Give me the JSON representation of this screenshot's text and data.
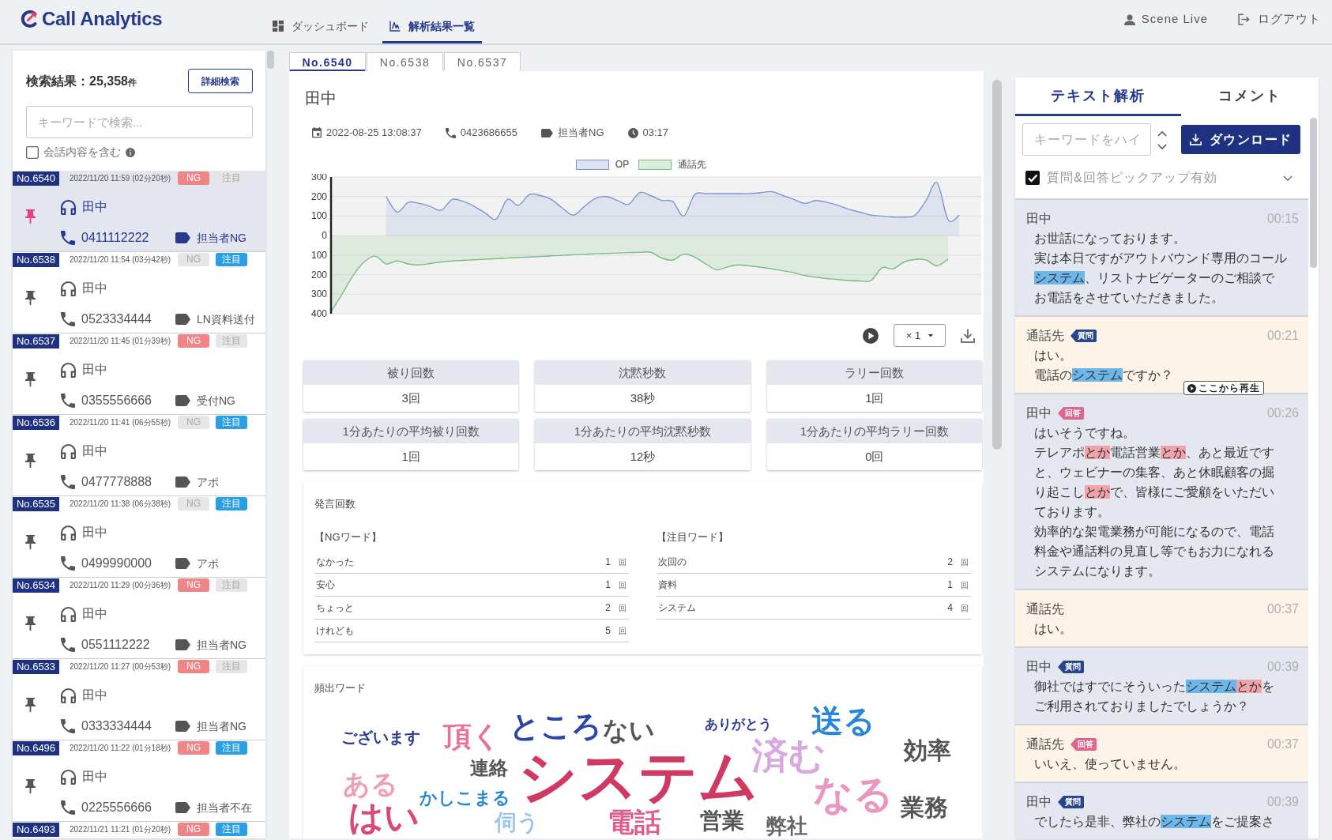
{
  "header": {
    "logo": "Call Analytics",
    "nav": [
      {
        "label": "ダッシュボード",
        "kind": "dashboard",
        "selected": false
      },
      {
        "label": "解析結果一覧",
        "kind": "analysis",
        "selected": true
      }
    ],
    "user": "Scene Live",
    "logout": "ログアウト"
  },
  "sidebar": {
    "result": {
      "label": "検索結果：",
      "count": "25,358",
      "unit": "件"
    },
    "detail_search": "詳細検索",
    "search": {
      "placeholder": "キーワードで検索..."
    },
    "include_conversation": {
      "label": "会話内容を含む",
      "checked": false
    },
    "calls": [
      {
        "no": "No.6540",
        "datetime": "2022/11/20 11:59 (02分20秒)",
        "badges": [
          {
            "kind": "ng",
            "label": "NG",
            "on": true
          },
          {
            "kind": "attention",
            "label": "注目",
            "on": false
          }
        ],
        "selected": true,
        "pinned": true,
        "name": "田中",
        "phone": "0411112222",
        "tag": "担当者NG"
      },
      {
        "no": "No.6538",
        "datetime": "2022/11/20 11:54 (03分42秒)",
        "badges": [
          {
            "kind": "ng",
            "label": "NG",
            "on": false
          },
          {
            "kind": "attention",
            "label": "注目",
            "on": true
          }
        ],
        "selected": false,
        "pinned": false,
        "name": "田中",
        "phone": "0523334444",
        "tag": "LN資料送付"
      },
      {
        "no": "No.6537",
        "datetime": "2022/11/20 11:45 (01分39秒)",
        "badges": [
          {
            "kind": "ng",
            "label": "NG",
            "on": true
          },
          {
            "kind": "attention",
            "label": "注目",
            "on": false
          }
        ],
        "selected": false,
        "pinned": false,
        "name": "田中",
        "phone": "0355556666",
        "tag": "受付NG"
      },
      {
        "no": "No.6536",
        "datetime": "2022/11/20 11:41 (06分55秒)",
        "badges": [
          {
            "kind": "ng",
            "label": "NG",
            "on": false
          },
          {
            "kind": "attention",
            "label": "注目",
            "on": true
          }
        ],
        "selected": false,
        "pinned": false,
        "name": "田中",
        "phone": "0477778888",
        "tag": "アポ"
      },
      {
        "no": "No.6535",
        "datetime": "2022/11/20 11:38 (06分38秒)",
        "badges": [
          {
            "kind": "ng",
            "label": "NG",
            "on": false
          },
          {
            "kind": "attention",
            "label": "注目",
            "on": true
          }
        ],
        "selected": false,
        "pinned": false,
        "name": "田中",
        "phone": "0499990000",
        "tag": "アポ"
      },
      {
        "no": "No.6534",
        "datetime": "2022/11/20 11:29 (00分36秒)",
        "badges": [
          {
            "kind": "ng",
            "label": "NG",
            "on": true
          },
          {
            "kind": "attention",
            "label": "注目",
            "on": false
          }
        ],
        "selected": false,
        "pinned": false,
        "name": "田中",
        "phone": "0551112222",
        "tag": "担当者NG"
      },
      {
        "no": "No.6533",
        "datetime": "2022/11/20 11:27 (00分53秒)",
        "badges": [
          {
            "kind": "ng",
            "label": "NG",
            "on": true
          },
          {
            "kind": "attention",
            "label": "注目",
            "on": false
          }
        ],
        "selected": false,
        "pinned": false,
        "name": "田中",
        "phone": "0333334444",
        "tag": "担当者NG"
      },
      {
        "no": "No.6496",
        "datetime": "2022/11/20 11:22 (01分18秒)",
        "badges": [
          {
            "kind": "ng",
            "label": "NG",
            "on": true
          },
          {
            "kind": "attention",
            "label": "注目",
            "on": true
          }
        ],
        "selected": false,
        "pinned": false,
        "name": "田中",
        "phone": "0225556666",
        "tag": "担当者不在"
      },
      {
        "no": "No.6493",
        "datetime": "2022/11/21 11:21 (01分20秒)",
        "badges": [
          {
            "kind": "ng",
            "label": "NG",
            "on": true
          },
          {
            "kind": "attention",
            "label": "注目",
            "on": true
          }
        ],
        "selected": false
      }
    ]
  },
  "tabs": [
    {
      "label": "No.6540",
      "selected": true
    },
    {
      "label": "No.6538",
      "selected": false
    },
    {
      "label": "No.6537",
      "selected": false
    }
  ],
  "detail": {
    "title": "田中",
    "meta": [
      {
        "kind": "date",
        "text": "2022-08-25 13:08:37"
      },
      {
        "kind": "phone",
        "text": "0423686655"
      },
      {
        "kind": "tag",
        "text": "担当者NG"
      },
      {
        "kind": "duration",
        "text": "03:17"
      }
    ],
    "chart_data": {
      "type": "area",
      "legend": "top",
      "grid": true,
      "series": [
        {
          "name": "OP",
          "color": "#7d97d1",
          "values": [
            null,
            null,
            null,
            null,
            null,
            200,
            120,
            170,
            165,
            150,
            130,
            185,
            175,
            150,
            115,
            85,
            185,
            155,
            210,
            205,
            185,
            140,
            105,
            150,
            190,
            200,
            180,
            160,
            220,
            205,
            180,
            175,
            100,
            210,
            215,
            215,
            215,
            215,
            215,
            220,
            225,
            205,
            185,
            165,
            180,
            170,
            155,
            135,
            120,
            105,
            100,
            95,
            95,
            105,
            180,
            270,
            80,
            105,
            null,
            null
          ]
        },
        {
          "name": "通話先",
          "color": "#78bf7f",
          "values": [
            -390,
            -300,
            -205,
            -135,
            -105,
            -145,
            -130,
            -145,
            -150,
            -143,
            -135,
            -130,
            -127,
            -124,
            -121,
            -118,
            -115,
            -112,
            -110,
            -107,
            -104,
            -101,
            -98,
            -96,
            -93,
            -91,
            -89,
            -87,
            -86,
            -85,
            -115,
            -125,
            -95,
            -110,
            -145,
            -175,
            -160,
            -150,
            -155,
            -162,
            -170,
            -180,
            -190,
            -205,
            -213,
            -220,
            -225,
            -230,
            -232,
            -230,
            -165,
            -170,
            -135,
            -122,
            -125,
            -155,
            -120,
            null,
            null,
            null
          ]
        }
      ],
      "ylim": [
        -400,
        300
      ],
      "yticks": [
        300,
        200,
        100,
        0,
        {
          "value": -100,
          "label": "100"
        },
        {
          "value": -200,
          "label": "200"
        },
        {
          "value": -300,
          "label": "300"
        },
        {
          "value": -400,
          "label": "400"
        }
      ]
    },
    "speed": "× 1",
    "stats": [
      {
        "label": "被り回数",
        "value": "3回"
      },
      {
        "label": "沈黙秒数",
        "value": "38秒"
      },
      {
        "label": "ラリー回数",
        "value": "1回"
      },
      {
        "label": "1分あたりの平均被り回数",
        "value": "1回"
      },
      {
        "label": "1分あたりの平均沈黙秒数",
        "value": "12秒"
      },
      {
        "label": "1分あたりの平均ラリー回数",
        "value": "0回"
      }
    ],
    "word_counts": {
      "title": "発言回数",
      "groups": [
        {
          "title": "【NGワード】",
          "rows": [
            {
              "word": "なかった",
              "count": "1",
              "unit": "回"
            },
            {
              "word": "安心",
              "count": "1",
              "unit": "回"
            },
            {
              "word": "ちょっと",
              "count": "2",
              "unit": "回"
            },
            {
              "word": "けれども",
              "count": "5",
              "unit": "回"
            }
          ]
        },
        {
          "title": "【注目ワード】",
          "rows": [
            {
              "word": "次回の",
              "count": "2",
              "unit": "回"
            },
            {
              "word": "資料",
              "count": "1",
              "unit": "回"
            },
            {
              "word": "システム",
              "count": "4",
              "unit": "回"
            }
          ]
        }
      ]
    },
    "word_cloud": {
      "title": "頻出ワード",
      "words": [
        {
          "text": "ございます",
          "color": "#2c3b92"
        },
        {
          "text": "頂く",
          "color": "#e8709a"
        },
        {
          "text": "ところ",
          "color": "#2c44a8"
        },
        {
          "text": "ない",
          "color": "#555555"
        },
        {
          "text": "ありがとう",
          "color": "#2c3b92"
        },
        {
          "text": "送る",
          "color": "#2a86d6"
        },
        {
          "text": "ある",
          "color": "#ef9fb5"
        },
        {
          "text": "連絡",
          "color": "#555555"
        },
        {
          "text": "かしこまる",
          "color": "#2a86d6"
        },
        {
          "text": "システム",
          "color": "#d03a62"
        },
        {
          "text": "済む",
          "color": "#d8a8e0"
        },
        {
          "text": "なる",
          "color": "#e996c0"
        },
        {
          "text": "効率",
          "color": "#555555"
        },
        {
          "text": "はい",
          "color": "#d8487a"
        },
        {
          "text": "伺う",
          "color": "#9fc7ee"
        },
        {
          "text": "電話",
          "color": "#e05c8c"
        },
        {
          "text": "営業",
          "color": "#555555"
        },
        {
          "text": "弊社",
          "color": "#666666"
        },
        {
          "text": "業務",
          "color": "#555555"
        }
      ]
    }
  },
  "transcript": {
    "tabs": [
      {
        "label": "テキスト解析",
        "selected": true
      },
      {
        "label": "コメント",
        "selected": false
      }
    ],
    "highlight": {
      "placeholder": "キーワードをハイ"
    },
    "download": "ダウンロード",
    "pickup": {
      "label": "質問&回答ピックアップ有効",
      "checked": true
    },
    "utterances": [
      {
        "speaker": "田中",
        "kind": "operator",
        "time": "00:15",
        "lines": [
          [
            {
              "text": "お世話になっております。",
              "kind": "plain"
            }
          ],
          [
            {
              "text": "実は本日ですがアウトバウンド専用のコール",
              "kind": "plain"
            }
          ],
          [
            {
              "text": "システム",
              "kind": "keyword"
            },
            {
              "text": "、リストナビゲーターのご相談で",
              "kind": "plain"
            }
          ],
          [
            {
              "text": "お電話をさせていただきました。",
              "kind": "plain"
            }
          ]
        ]
      },
      {
        "speaker": "通話先",
        "kind": "customer",
        "tag": {
          "kind": "question",
          "label": "質問"
        },
        "time": "00:21",
        "lines": [
          [
            {
              "text": "はい。",
              "kind": "plain"
            }
          ],
          [
            {
              "text": "電話の",
              "kind": "plain"
            },
            {
              "text": "システム",
              "kind": "keyword"
            },
            {
              "text": "ですか？",
              "kind": "plain"
            }
          ]
        ],
        "play": "ここから再生"
      },
      {
        "speaker": "田中",
        "kind": "operator",
        "tag": {
          "kind": "answer",
          "label": "回答"
        },
        "time": "00:26",
        "lines": [
          [
            {
              "text": "はいそうですね。",
              "kind": "plain"
            }
          ],
          [
            {
              "text": "テレアポ",
              "kind": "plain"
            },
            {
              "text": "とか",
              "kind": "ng"
            },
            {
              "text": "電話営業",
              "kind": "plain"
            },
            {
              "text": "とか",
              "kind": "ng"
            },
            {
              "text": "、あと最近です",
              "kind": "plain"
            }
          ],
          [
            {
              "text": "と、ウェビナーの集客、あと休眠顧客の掘",
              "kind": "plain"
            }
          ],
          [
            {
              "text": "り起こし",
              "kind": "plain"
            },
            {
              "text": "とか",
              "kind": "ng"
            },
            {
              "text": "で、皆様にご愛顧をいただい",
              "kind": "plain"
            }
          ],
          [
            {
              "text": "ております。",
              "kind": "plain"
            }
          ],
          [
            {
              "text": "効率的な架電業務が可能になるので、電話",
              "kind": "plain"
            }
          ],
          [
            {
              "text": "料金や通話料の見直し等でもお力になれる",
              "kind": "plain"
            }
          ],
          [
            {
              "text": "システムになります。",
              "kind": "plain"
            }
          ]
        ]
      },
      {
        "speaker": "通話先",
        "kind": "customer",
        "time": "00:37",
        "lines": [
          [
            {
              "text": "はい。",
              "kind": "plain"
            }
          ]
        ]
      },
      {
        "speaker": "田中",
        "kind": "operator",
        "tag": {
          "kind": "question",
          "label": "質問"
        },
        "time": "00:39",
        "lines": [
          [
            {
              "text": "御社ではすでにそういった",
              "kind": "plain"
            },
            {
              "text": "システム",
              "kind": "keyword"
            },
            {
              "text": "とか",
              "kind": "ng"
            },
            {
              "text": "を",
              "kind": "plain"
            }
          ],
          [
            {
              "text": "ご利用されておりましたでしょうか？",
              "kind": "plain"
            }
          ]
        ]
      },
      {
        "speaker": "通話先",
        "kind": "customer",
        "tag": {
          "kind": "answer",
          "label": "回答"
        },
        "time": "00:37",
        "lines": [
          [
            {
              "text": "いいえ、使っていません。",
              "kind": "plain"
            }
          ]
        ]
      },
      {
        "speaker": "田中",
        "kind": "operator",
        "tag": {
          "kind": "question",
          "label": "質問"
        },
        "time": "00:39",
        "lines": [
          [
            {
              "text": "でしたら是非、弊社の",
              "kind": "plain"
            },
            {
              "text": "システム",
              "kind": "keyword"
            },
            {
              "text": "をご提案さ",
              "kind": "plain"
            }
          ]
        ]
      }
    ]
  }
}
